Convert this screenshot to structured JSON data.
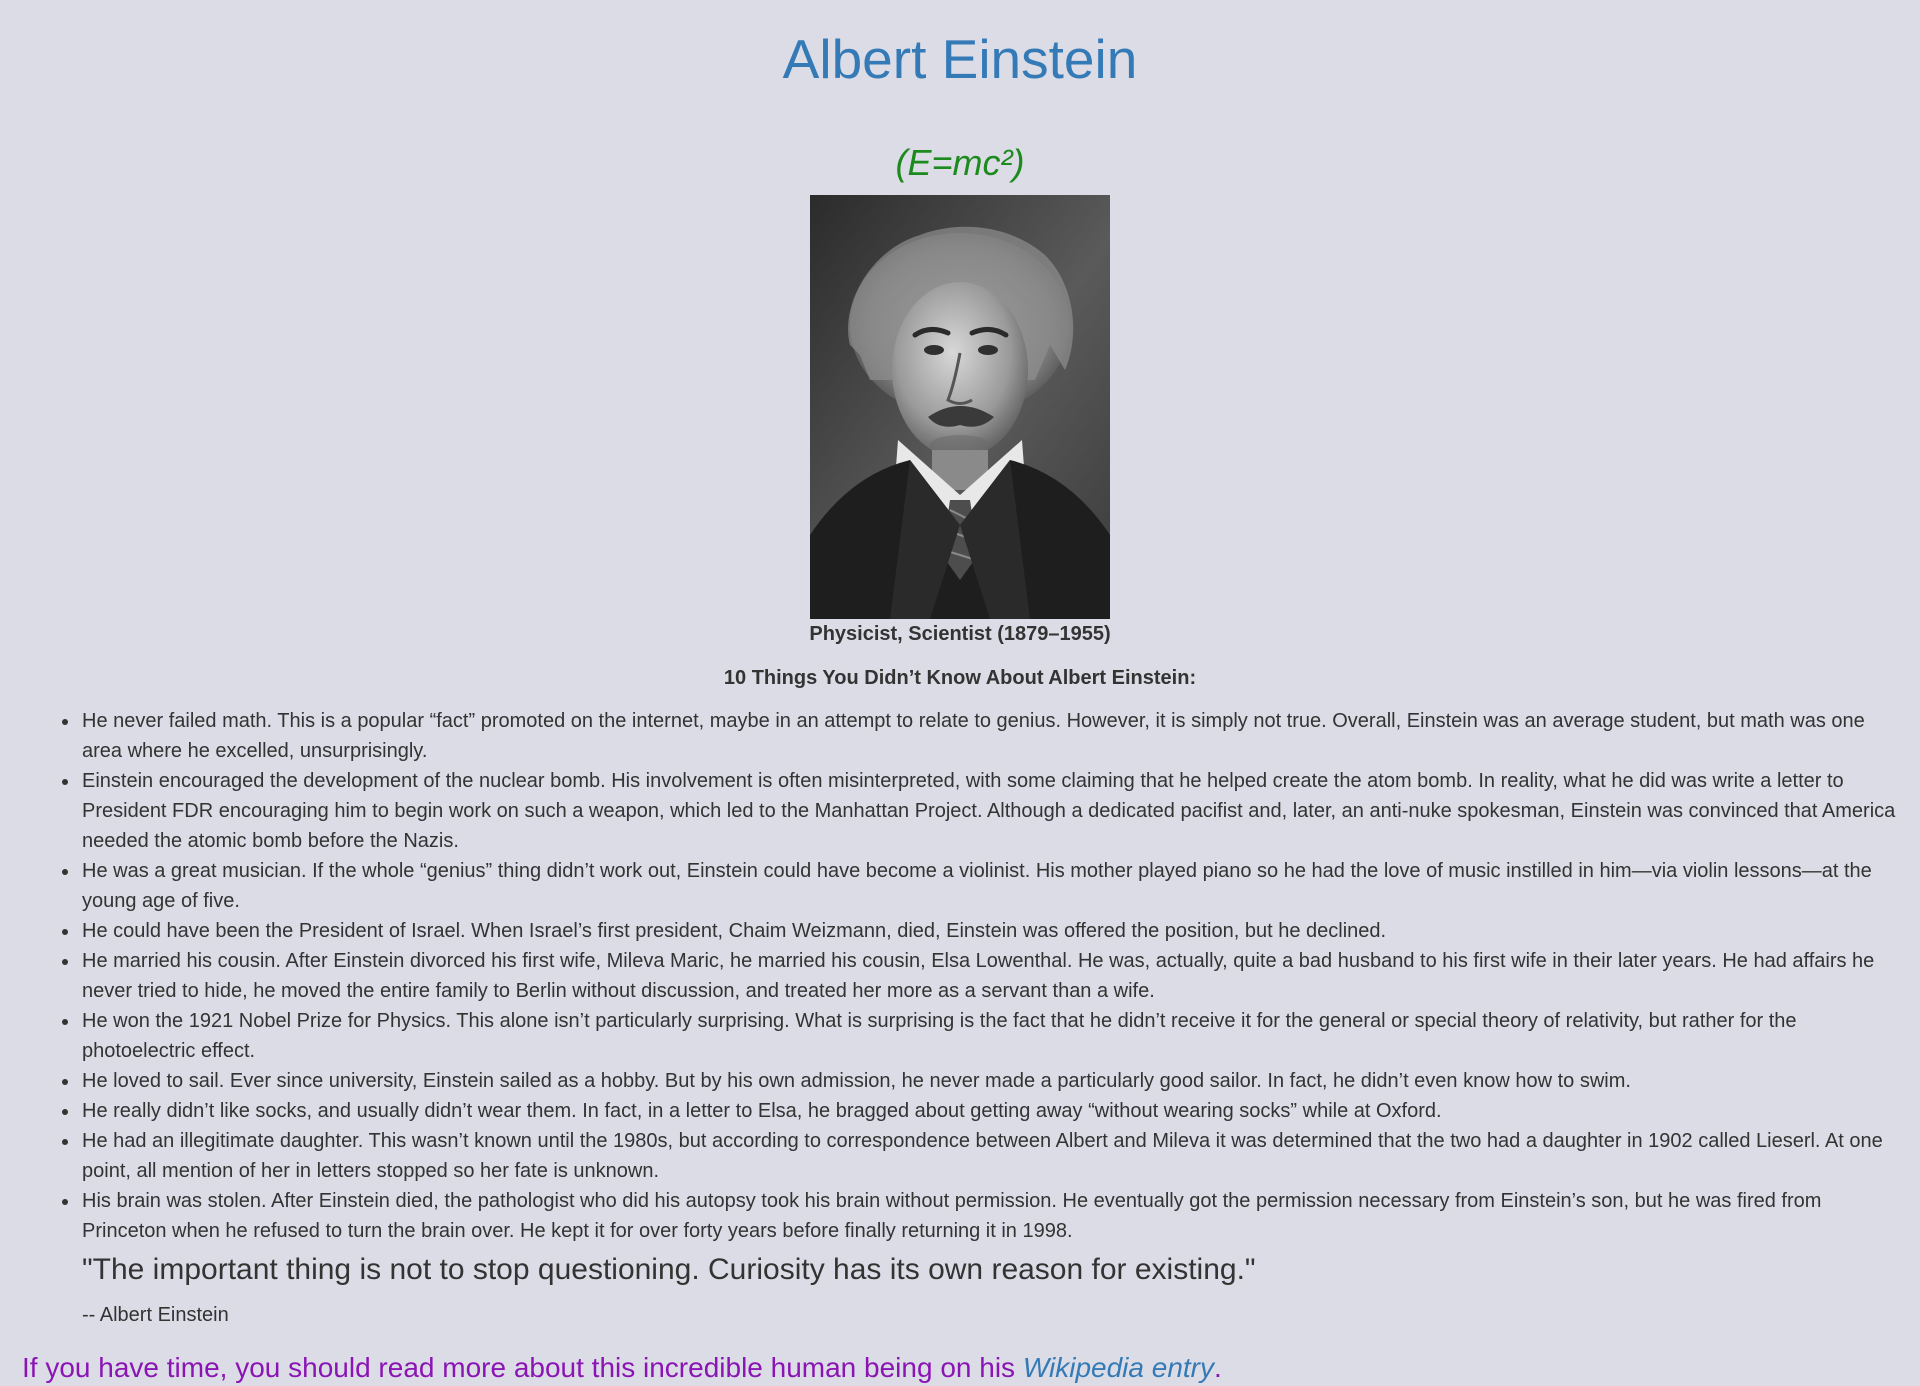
{
  "title": "Albert Einstein",
  "formula": "(E=mc²)",
  "portrait": {
    "alt": "Black and white portrait of Albert Einstein",
    "caption": "Physicist, Scientist (1879–1955)"
  },
  "intro": "10 Things You Didn’t Know About Albert Einstein:",
  "facts": [
    "He never failed math. This is a popular “fact” promoted on the internet, maybe in an attempt to relate to genius. However, it is simply not true. Overall, Einstein was an average student, but math was one area where he excelled, unsurprisingly.",
    "Einstein encouraged the development of the nuclear bomb. His involvement is often misinterpreted, with some claiming that he helped create the atom bomb. In reality, what he did was write a letter to President FDR encouraging him to begin work on such a weapon, which led to the Manhattan Project. Although a dedicated pacifist and, later, an anti-nuke spokesman, Einstein was convinced that America needed the atomic bomb before the Nazis.",
    "He was a great musician. If the whole “genius” thing didn’t work out, Einstein could have become a violinist. His mother played piano so he had the love of music instilled in him—via violin lessons—at the young age of five.",
    "He could have been the President of Israel. When Israel’s first president, Chaim Weizmann, died, Einstein was offered the position, but he declined.",
    "He married his cousin. After Einstein divorced his first wife, Mileva Maric, he married his cousin, Elsa Lowenthal. He was, actually, quite a bad husband to his first wife in their later years. He had affairs he never tried to hide, he moved the entire family to Berlin without discussion, and treated her more as a servant than a wife.",
    "He won the 1921 Nobel Prize for Physics. This alone isn’t particularly surprising. What is surprising is the fact that he didn’t receive it for the general or special theory of relativity, but rather for the photoelectric effect.",
    "He loved to sail. Ever since university, Einstein sailed as a hobby. But by his own admission, he never made a particularly good sailor. In fact, he didn’t even know how to swim.",
    "He really didn’t like socks, and usually didn’t wear them. In fact, in a letter to Elsa, he bragged about getting away “without wearing socks” while at Oxford.",
    "He had an illegitimate daughter. This wasn’t known until the 1980s, but according to correspondence between Albert and Mileva it was determined that the two had a daughter in 1902 called Lieserl. At one point, all mention of her in letters stopped so her fate is unknown.",
    "His brain was stolen. After Einstein died, the pathologist who did his autopsy took his brain without permission. He eventually got the permission necessary from Einstein’s son, but he was fired from Princeton when he refused to turn the brain over. He kept it for over forty years before finally returning it in 1998."
  ],
  "quote": {
    "text": "\"The important thing is not to stop questioning. Curiosity has its own reason for existing.\"",
    "author": "-- Albert Einstein"
  },
  "more": {
    "prefix": "If you have time, you should read more about this incredible human being on his ",
    "link_text": "Wikipedia entry",
    "suffix": "."
  },
  "colors": {
    "background": "#dcdce6",
    "title": "#337ab7",
    "formula": "#1d8a1d",
    "body_text": "#333333",
    "more_text": "#8a14b4",
    "link": "#337ab7"
  }
}
